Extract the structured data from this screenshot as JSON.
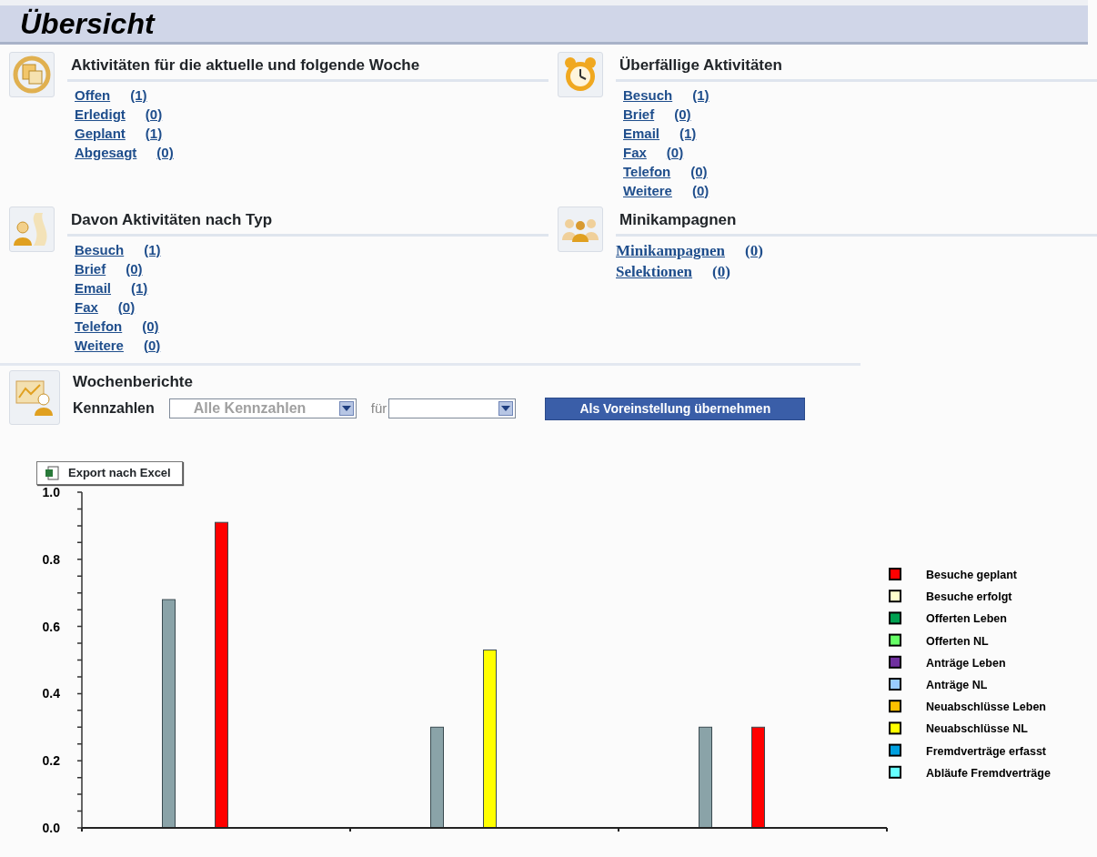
{
  "title": "Übersicht",
  "sections": [
    {
      "heading": "Aktivitäten für die aktuelle und folgende Woche",
      "kind": "sans",
      "links": [
        {
          "label": "Offen",
          "count": "(1)"
        },
        {
          "label": "Erledigt",
          "count": "(0)"
        },
        {
          "label": "Geplant",
          "count": "(1)"
        },
        {
          "label": "Abgesagt",
          "count": "(0)"
        }
      ]
    },
    {
      "heading": "Überfällige Aktivitäten",
      "kind": "sans",
      "links": [
        {
          "label": "Besuch",
          "count": "(1)"
        },
        {
          "label": "Brief",
          "count": "(0)"
        },
        {
          "label": "Email",
          "count": "(1)"
        },
        {
          "label": "Fax",
          "count": "(0)"
        },
        {
          "label": "Telefon",
          "count": "(0)"
        },
        {
          "label": "Weitere",
          "count": "(0)"
        }
      ]
    },
    {
      "heading": "Davon Aktivitäten nach Typ",
      "kind": "sans",
      "links": [
        {
          "label": "Besuch",
          "count": "(1)"
        },
        {
          "label": "Brief",
          "count": "(0)"
        },
        {
          "label": "Email",
          "count": "(1)"
        },
        {
          "label": "Fax",
          "count": "(0)"
        },
        {
          "label": "Telefon",
          "count": "(0)"
        },
        {
          "label": "Weitere",
          "count": "(0)"
        }
      ]
    },
    {
      "heading": "Minikampagnen",
      "kind": "serif",
      "links": [
        {
          "label": "Minikampagnen",
          "count": "(0)"
        },
        {
          "label": "Selektionen",
          "count": "(0)"
        }
      ]
    }
  ],
  "reports": {
    "heading": "Wochenberichte",
    "filter_label": "Kennzahlen",
    "kpi_select": "Alle Kennzahlen",
    "for_label": "für",
    "apply_button": "Als Voreinstellung übernehmen",
    "export_button": "Export nach Excel",
    "chart_data": {
      "type": "bar",
      "legend": true,
      "ylim": [
        0,
        1
      ],
      "yticks": [
        {
          "value": 0,
          "label": "0.0"
        },
        {
          "value": 0.2,
          "label": "0.2"
        },
        {
          "value": 0.4,
          "label": "0.4"
        },
        {
          "value": 0.6,
          "label": "0.6"
        },
        {
          "value": 0.8,
          "label": "0.8"
        },
        {
          "value": 1,
          "label": "1.0"
        }
      ],
      "series": [
        {
          "color": "#8aa3a8",
          "values": [
            0.68,
            0.3,
            0.3
          ]
        },
        {
          "name": "Besuche geplant",
          "color": "#ff0000",
          "values": [
            0.91,
            null,
            0.3
          ]
        },
        {
          "name": "Besuche erfolgt",
          "color": "#ffffcc",
          "values": [
            null,
            null,
            null
          ]
        },
        {
          "name": "Offerten Leben",
          "color": "#00a050",
          "values": [
            null,
            null,
            null
          ]
        },
        {
          "name": "Offerten NL",
          "color": "#66ff66",
          "values": [
            null,
            null,
            null
          ]
        },
        {
          "name": "Anträge Leben",
          "color": "#7030a0",
          "values": [
            null,
            null,
            null
          ]
        },
        {
          "name": "Anträge NL",
          "color": "#99ccff",
          "values": [
            null,
            null,
            null
          ]
        },
        {
          "name": "Neuabschlüsse Leben",
          "color": "#ffc000",
          "values": [
            null,
            null,
            null
          ]
        },
        {
          "name": "Neuabschlüsse NL",
          "color": "#ffff00",
          "values": [
            null,
            0.53,
            null
          ]
        },
        {
          "name": "Fremdverträge erfasst",
          "color": "#00a0e0",
          "values": [
            null,
            null,
            null
          ]
        },
        {
          "name": "Abläufe Fremdverträge",
          "color": "#66ffff",
          "values": [
            null,
            null,
            null
          ]
        }
      ]
    }
  }
}
